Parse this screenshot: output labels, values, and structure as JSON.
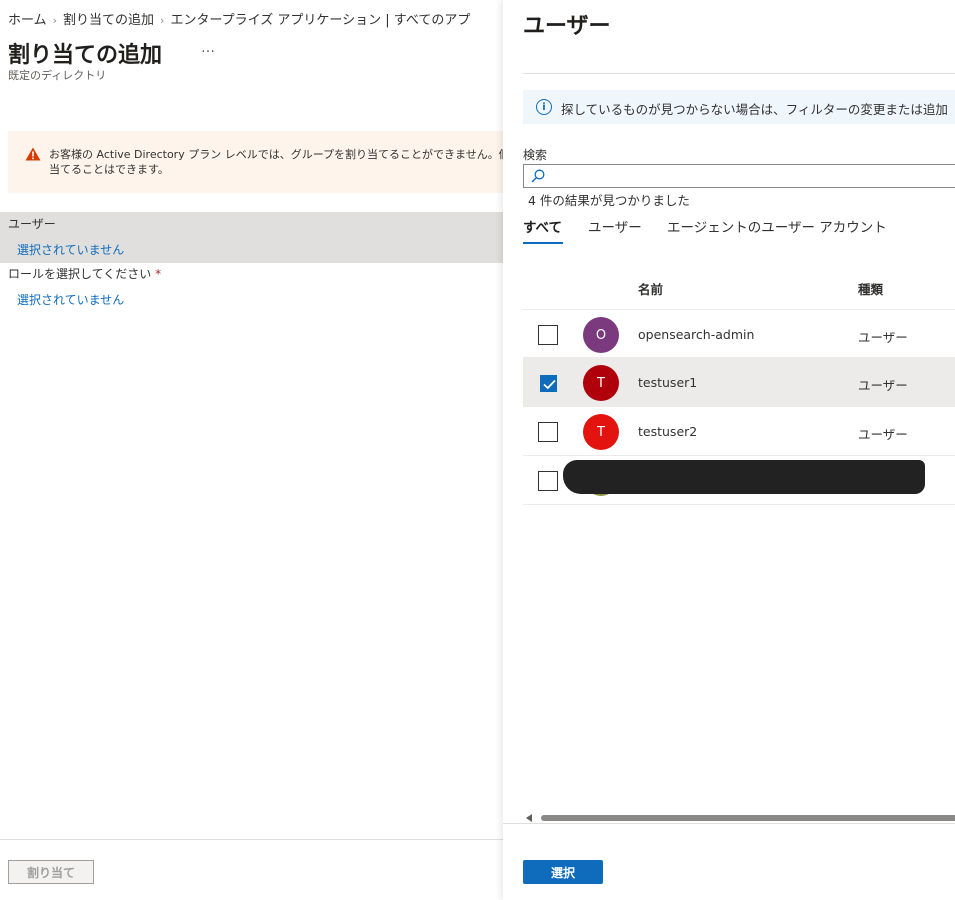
{
  "breadcrumb": {
    "items": [
      "ホーム",
      "割り当ての追加",
      "エンタープライズ アプリケーション | すべてのアプ"
    ]
  },
  "page": {
    "title": "割り当ての追加",
    "more_label": "…",
    "subtitle": "既定のディレクトリ"
  },
  "warning": {
    "line1": "お客様の Active Directory プラン レベルでは、グループを割り当てることができません。個々のユ",
    "line2": "当てることはできます。",
    "color": "#d83b01"
  },
  "assignment": {
    "user_label": "ユーザー",
    "user_value": "選択されていません",
    "role_label": "ロールを選択してください",
    "role_required": "*",
    "role_value": "選択されていません"
  },
  "footer": {
    "assign_label": "割り当て"
  },
  "panel": {
    "title": "ユーザー",
    "info_icon": "i",
    "info_text": "探しているものが見つからない場合は、フィルターの変更または追加",
    "search_label": "検索",
    "search_value": "",
    "search_placeholder": "",
    "result_count": "4 件の結果が見つかりました",
    "tabs": [
      {
        "label": "すべて",
        "active": true
      },
      {
        "label": "ユーザー",
        "active": false
      },
      {
        "label": "エージェントのユーザー アカウント",
        "active": false
      }
    ],
    "columns": {
      "name": "名前",
      "type": "種類"
    },
    "rows": [
      {
        "initial": "O",
        "name": "opensearch-admin",
        "type": "ユーザー",
        "checked": false,
        "avatar_color": "#7b3a7d"
      },
      {
        "initial": "T",
        "name": "testuser1",
        "type": "ユーザー",
        "checked": true,
        "avatar_color": "#b0000b"
      },
      {
        "initial": "T",
        "name": "testuser2",
        "type": "ユーザー",
        "checked": false,
        "avatar_color": "#e3140f"
      },
      {
        "initial": "",
        "name": "",
        "type": "",
        "checked": false,
        "redacted": true
      }
    ],
    "select_label": "選択",
    "accent_color": "#0f6cbd"
  }
}
